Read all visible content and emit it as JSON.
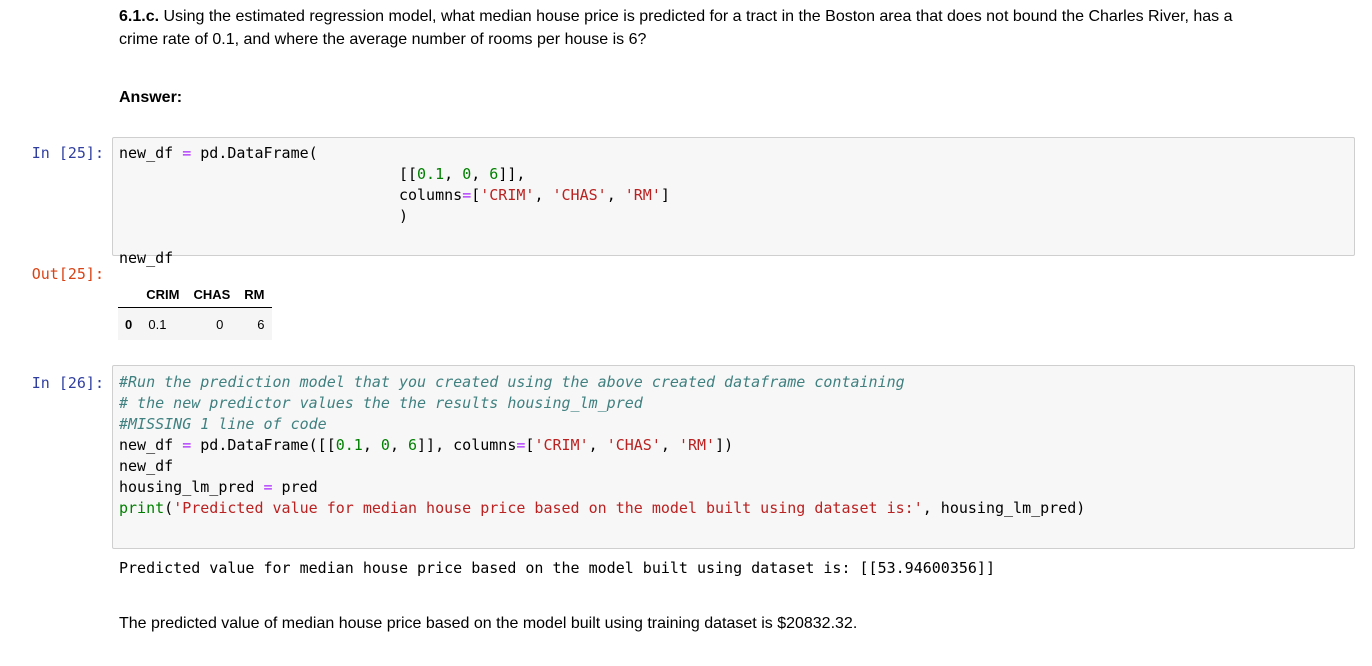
{
  "question": {
    "label": "6.1.c.",
    "text_line1": " Using the estimated regression model, what median house price is predicted for a tract in the Boston area that does not bound the Charles River, has a",
    "text_line2": "crime rate of 0.1, and where the average number of rooms per house is 6?"
  },
  "answer_heading": "Answer:",
  "cell25": {
    "in_prompt": "In [25]:",
    "out_prompt": "Out[25]:",
    "code": {
      "l1_a": "new_df ",
      "l1_eq": "=",
      "l1_b": " pd.DataFrame(",
      "l2_indent": "                               ",
      "l2_open": "[[",
      "l2_n1": "0.1",
      "l2_sep1": ", ",
      "l2_n2": "0",
      "l2_sep2": ", ",
      "l2_n3": "6",
      "l2_close": "]],",
      "l3_indent": "                               ",
      "l3_a": "columns",
      "l3_eq": "=",
      "l3_b": "[",
      "l3_s1": "'CRIM'",
      "l3_c1": ", ",
      "l3_s2": "'CHAS'",
      "l3_c2": ", ",
      "l3_s3": "'RM'",
      "l3_c": "]",
      "l4": "                               )",
      "l6": "new_df"
    },
    "table": {
      "columns": [
        "CRIM",
        "CHAS",
        "RM"
      ],
      "rows": [
        {
          "index": "0",
          "values": [
            "0.1",
            "0",
            "6"
          ]
        }
      ]
    }
  },
  "cell26": {
    "in_prompt": "In [26]:",
    "code": {
      "c1": "#Run the prediction model that you created using the above created dataframe containing",
      "c2": "# the new predictor values the the results housing_lm_pred",
      "c3": "#MISSING 1 line of code",
      "l4_a": "new_df ",
      "l4_eq": "=",
      "l4_b": " pd.DataFrame([[",
      "l4_n1": "0.1",
      "l4_s1": ", ",
      "l4_n2": "0",
      "l4_s2": ", ",
      "l4_n3": "6",
      "l4_c": "]], columns",
      "l4_eq2": "=",
      "l4_d": "[",
      "l4_st1": "'CRIM'",
      "l4_k1": ", ",
      "l4_st2": "'CHAS'",
      "l4_k2": ", ",
      "l4_st3": "'RM'",
      "l4_e": "])",
      "l5": "new_df",
      "l6_a": "housing_lm_pred ",
      "l6_eq": "=",
      "l6_b": " pred",
      "l7_print": "print",
      "l7_open": "(",
      "l7_str": "'Predicted value for median house price based on the model built using dataset is:'",
      "l7_rest": ", housing_lm_pred)"
    },
    "output": "Predicted value for median house price based on the model built using dataset is: [[53.94600356]]"
  },
  "conclusion": "The predicted value of median house price based on the model built using training dataset is $20832.32."
}
